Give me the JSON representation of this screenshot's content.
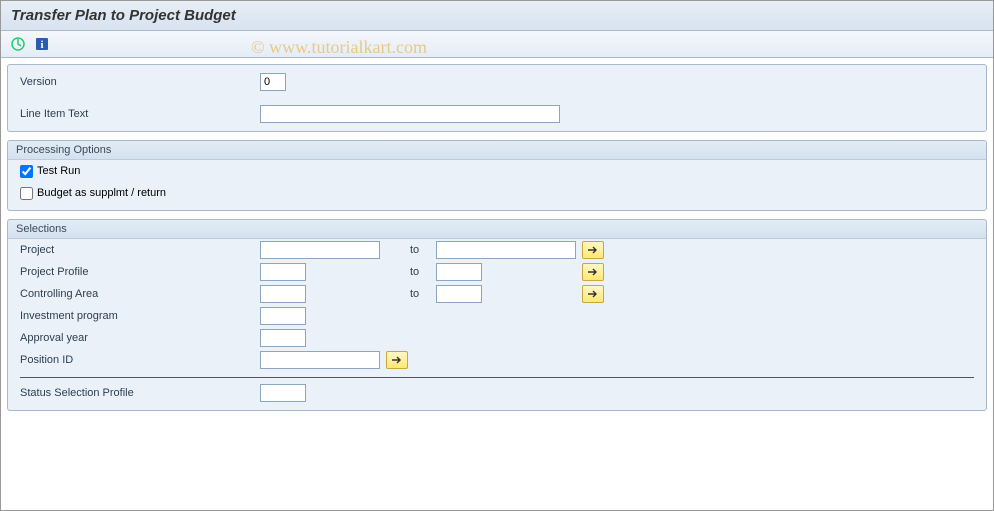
{
  "title": "Transfer Plan to Project Budget",
  "watermark": "© www.tutorialkart.com",
  "toolbar": {
    "execute_icon": "execute",
    "info_icon": "information"
  },
  "top": {
    "version_label": "Version",
    "version_value": "0",
    "line_item_text_label": "Line Item Text",
    "line_item_text_value": ""
  },
  "processing": {
    "title": "Processing Options",
    "test_run_label": "Test Run",
    "test_run_checked": true,
    "budget_supplmt_label": "Budget as supplmt / return",
    "budget_supplmt_checked": false
  },
  "selections": {
    "title": "Selections",
    "to_label": "to",
    "rows": [
      {
        "label": "Project",
        "from": "",
        "to": "",
        "from_w": "inp-md",
        "to_w": "inp-xl",
        "multi": true
      },
      {
        "label": "Project Profile",
        "from": "",
        "to": "",
        "from_w": "inp-sm",
        "to_w": "inp-sm",
        "multi": true
      },
      {
        "label": "Controlling Area",
        "from": "",
        "to": "",
        "from_w": "inp-sm",
        "to_w": "inp-sm",
        "multi": true
      },
      {
        "label": "Investment program",
        "from": "",
        "to": null,
        "from_w": "inp-sm",
        "multi": false
      },
      {
        "label": "Approval year",
        "from": "",
        "to": null,
        "from_w": "inp-sm",
        "multi": false
      },
      {
        "label": "Position ID",
        "from": "",
        "to": null,
        "from_w": "inp-md",
        "multi": true
      }
    ],
    "status_profile_label": "Status Selection Profile",
    "status_profile_value": ""
  }
}
